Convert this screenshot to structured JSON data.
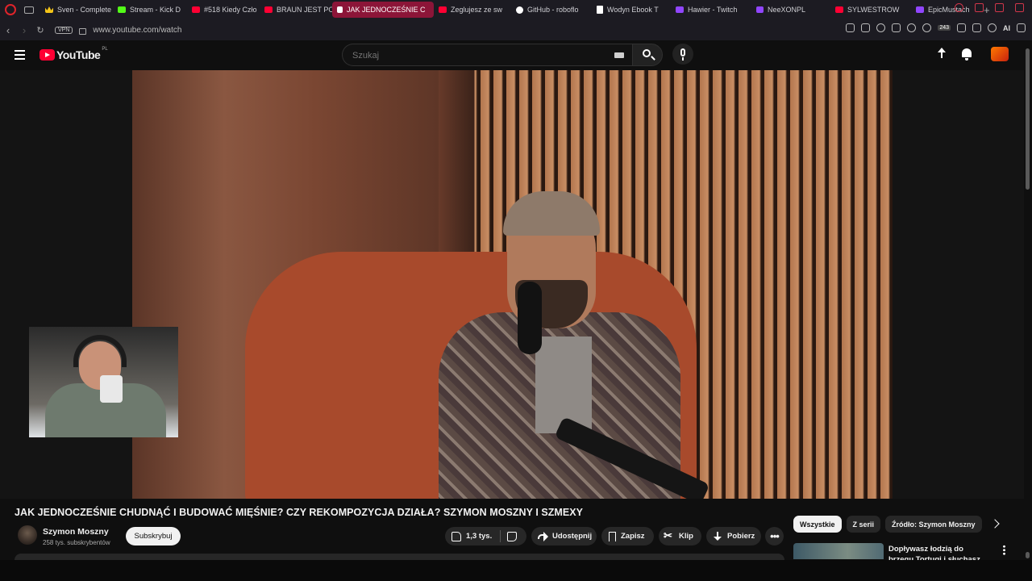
{
  "browser": {
    "tabs": [
      {
        "label": "Sven - Complete",
        "icon": "crown-icon"
      },
      {
        "label": "Stream - Kick D",
        "icon": "kick-icon"
      },
      {
        "label": "#518 Kiedy Czło",
        "icon": "youtube-icon"
      },
      {
        "label": "BRAUN JEST PO",
        "icon": "youtube-icon"
      },
      {
        "label": "JAK JEDNOCZEŚNIE C",
        "icon": "speaker-icon",
        "active": true
      },
      {
        "label": "Zegluje​sz ze sw",
        "icon": "youtube-icon"
      },
      {
        "label": "GitHub - roboflo",
        "icon": "github-icon"
      },
      {
        "label": "Wodyn Ebook T",
        "icon": "document-icon"
      },
      {
        "label": "Hawier - Twitch",
        "icon": "twitch-icon"
      },
      {
        "label": "NeeXONPL",
        "icon": "kick-icon"
      },
      {
        "label": "SYLWESTROW",
        "icon": "youtube-icon"
      },
      {
        "label": "EpicMustach",
        "icon": "twitch-icon"
      }
    ],
    "url": "www.youtube.com/watch",
    "vpn_label": "VPN",
    "ext_badge": "243",
    "ai_label": "AI"
  },
  "youtube": {
    "logo_text": "YouTube",
    "country_code": "PL",
    "search_placeholder": "Szukaj"
  },
  "video": {
    "title": "JAK JEDNOCZEŚNIE CHUDNĄĆ I BUDOWAĆ MIĘŚNIE? CZY REKOMPOZYCJA DZIAŁA? SZYMON MOSZNY I SZMEXY",
    "channel_name": "Szymon Moszny",
    "subscribers": "258 tys. subskrybentów",
    "subscribe_label": "Subskrybuj",
    "likes": "1,3 tys.",
    "share_label": "Udostępnij",
    "save_label": "Zapisz",
    "clip_label": "Klip",
    "download_label": "Pobierz"
  },
  "sidebar": {
    "chips": [
      "Wszystkie",
      "Z serii",
      "Źródło: Szymon Moszny"
    ],
    "recommendation_title": "Dopływasz łodzią do brzegu Tortugi i słuchasz szant"
  },
  "colors": {
    "accent": "#ff0033",
    "background": "#0f0f0f",
    "active_tab": "#8c1538"
  }
}
